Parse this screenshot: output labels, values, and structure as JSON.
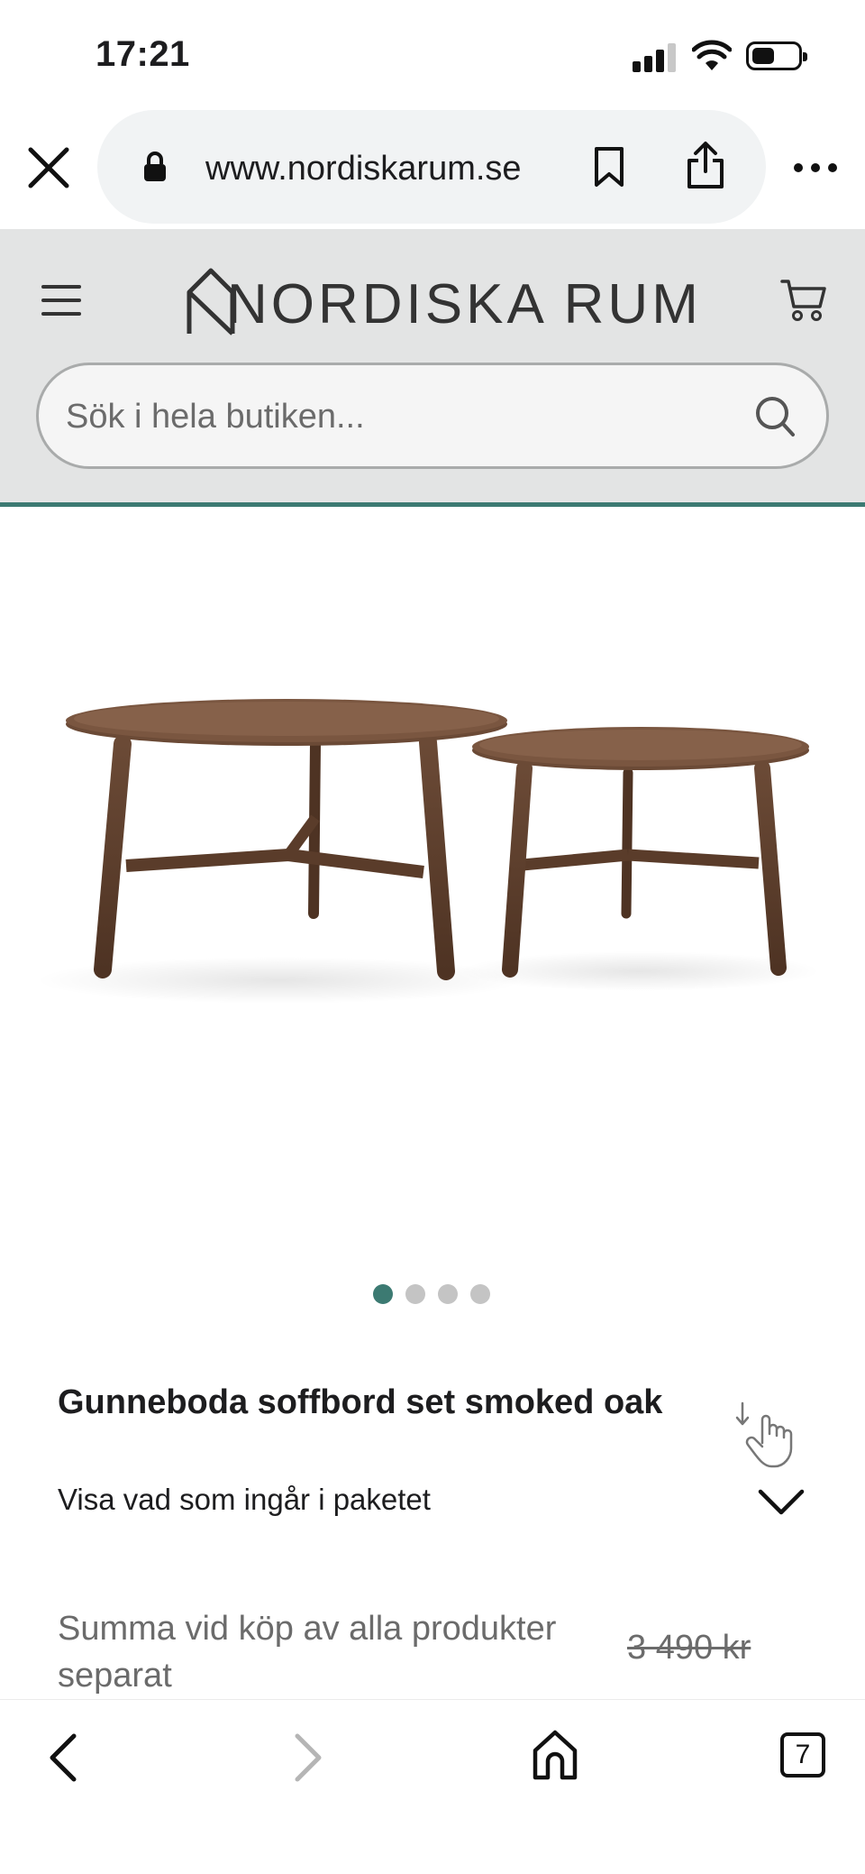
{
  "status_bar": {
    "time": "17:21",
    "icons": [
      "signal-icon",
      "wifi-icon",
      "battery-icon"
    ]
  },
  "browser": {
    "url": "www.nordiskarum.se",
    "icons": [
      "close-icon",
      "lock-icon",
      "bookmark-icon",
      "share-icon",
      "more-icon"
    ]
  },
  "header": {
    "logo_text": "NORDISKA RUM",
    "search_placeholder": "Sök i hela butiken...",
    "icons": [
      "menu-icon",
      "cart-icon",
      "search-icon"
    ],
    "accent_color": "#3c7a72",
    "background_color": "#e3e4e4"
  },
  "carousel": {
    "total": 4,
    "active_index": 0
  },
  "product": {
    "title": "Gunneboda soffbord set smoked oak",
    "package_label": "Visa vad som ingår i paketet",
    "sum_label": "Summa vid köp av alla produkter separat",
    "old_price": "3 490 kr"
  },
  "toolbar": {
    "tab_count": "7",
    "icons": [
      "back-icon",
      "forward-icon",
      "home-icon",
      "tabs-icon"
    ]
  }
}
